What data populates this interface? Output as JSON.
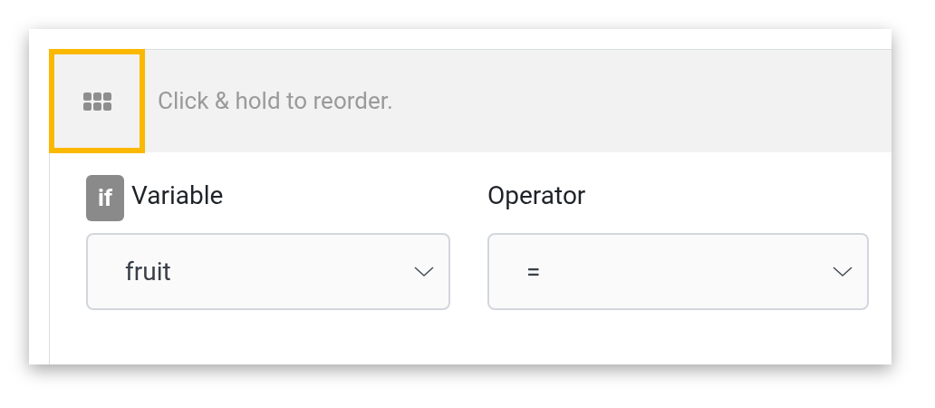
{
  "header": {
    "handle": {
      "highlighted": true
    },
    "hint": "Click & hold to reorder."
  },
  "fields": [
    {
      "badge": "if",
      "label": "Variable",
      "value": "fruit"
    },
    {
      "label": "Operator",
      "value": "="
    }
  ]
}
